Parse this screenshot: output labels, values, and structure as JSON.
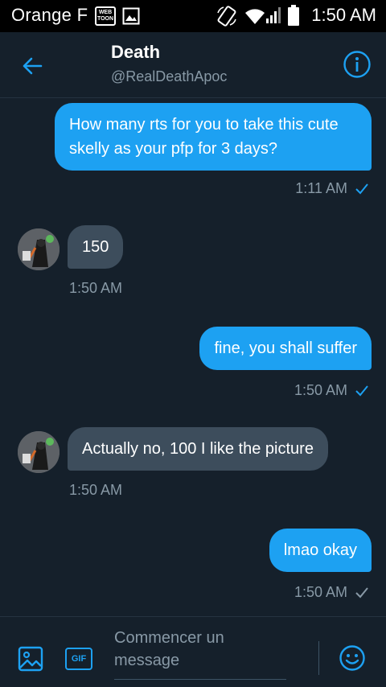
{
  "status_bar": {
    "carrier": "Orange F",
    "webtoon_text": "WEB TOON",
    "time": "1:50 AM"
  },
  "header": {
    "name": "Death",
    "handle": "@RealDeathApoc"
  },
  "messages": [
    {
      "direction": "sent",
      "text": "How many rts for you to take this cute skelly as your pfp for 3 days?",
      "time": "1:11 AM"
    },
    {
      "direction": "received",
      "text": "150",
      "time": "1:50 AM"
    },
    {
      "direction": "sent",
      "text": "fine, you shall suffer",
      "time": "1:50 AM"
    },
    {
      "direction": "received",
      "text": "Actually no, 100 I like the picture",
      "time": "1:50 AM"
    },
    {
      "direction": "sent",
      "text": "lmao okay",
      "time": "1:50 AM"
    }
  ],
  "composer": {
    "placeholder": "Commencer un message",
    "gif_label": "GIF"
  },
  "colors": {
    "background": "#15202b",
    "accent": "#1da1f2",
    "received_bubble": "#3d4d5c",
    "muted_text": "#8899a6"
  },
  "icons": [
    "back-arrow-icon",
    "info-icon",
    "image-icon",
    "gif-icon",
    "emoji-icon",
    "check-icon",
    "wifi-icon",
    "signal-icon",
    "battery-icon",
    "rotate-icon",
    "gallery-icon"
  ]
}
